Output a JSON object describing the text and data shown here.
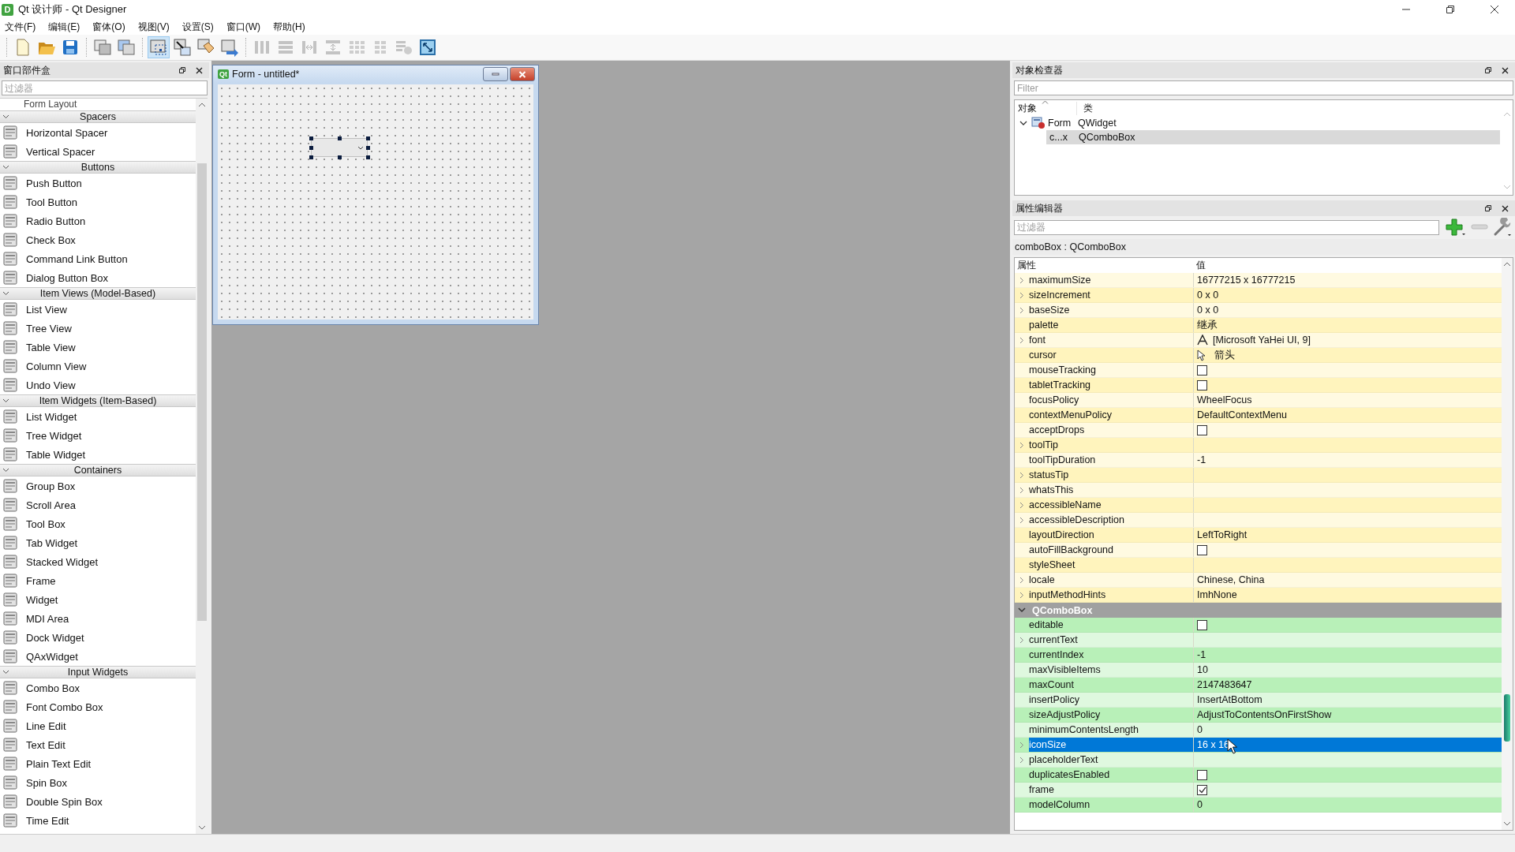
{
  "window": {
    "app_icon": "D",
    "title": "Qt 设计师 - Qt Designer"
  },
  "menu": [
    "文件(F)",
    "编辑(E)",
    "窗体(O)",
    "视图(V)",
    "设置(S)",
    "窗口(W)",
    "帮助(H)"
  ],
  "toolbar_groups": [
    [
      {
        "kind": "new",
        "selected": false,
        "disabled": false
      },
      {
        "kind": "open",
        "selected": false,
        "disabled": false
      },
      {
        "kind": "save",
        "selected": false,
        "disabled": false
      }
    ],
    [
      {
        "kind": "back",
        "selected": false,
        "disabled": false
      },
      {
        "kind": "front",
        "selected": false,
        "disabled": false
      }
    ],
    [
      {
        "kind": "widgets",
        "selected": true,
        "disabled": false
      },
      {
        "kind": "signals",
        "selected": false,
        "disabled": false
      },
      {
        "kind": "buddies",
        "selected": false,
        "disabled": false
      },
      {
        "kind": "taborder",
        "selected": false,
        "disabled": false
      }
    ],
    [
      {
        "kind": "hlayout",
        "selected": false,
        "disabled": true
      },
      {
        "kind": "vlayout",
        "selected": false,
        "disabled": true
      },
      {
        "kind": "hsplit",
        "selected": false,
        "disabled": true
      },
      {
        "kind": "vsplit",
        "selected": false,
        "disabled": true
      },
      {
        "kind": "grid",
        "selected": false,
        "disabled": true
      },
      {
        "kind": "form",
        "selected": false,
        "disabled": true
      },
      {
        "kind": "break",
        "selected": false,
        "disabled": true
      },
      {
        "kind": "adjust",
        "selected": false,
        "disabled": false
      }
    ]
  ],
  "widget_box": {
    "title": "窗口部件盒",
    "filter_placeholder": "过滤器",
    "clipped_item": "Form Layout",
    "categories": [
      {
        "title": "Spacers",
        "expanded": true,
        "items": [
          "Horizontal Spacer",
          "Vertical Spacer"
        ]
      },
      {
        "title": "Buttons",
        "expanded": true,
        "items": [
          "Push Button",
          "Tool Button",
          "Radio Button",
          "Check Box",
          "Command Link Button",
          "Dialog Button Box"
        ]
      },
      {
        "title": "Item Views (Model-Based)",
        "expanded": true,
        "items": [
          "List View",
          "Tree View",
          "Table View",
          "Column View",
          "Undo View"
        ]
      },
      {
        "title": "Item Widgets (Item-Based)",
        "expanded": true,
        "items": [
          "List Widget",
          "Tree Widget",
          "Table Widget"
        ]
      },
      {
        "title": "Containers",
        "expanded": true,
        "items": [
          "Group Box",
          "Scroll Area",
          "Tool Box",
          "Tab Widget",
          "Stacked Widget",
          "Frame",
          "Widget",
          "MDI Area",
          "Dock Widget",
          "QAxWidget"
        ]
      },
      {
        "title": "Input Widgets",
        "expanded": true,
        "items": [
          "Combo Box",
          "Font Combo Box",
          "Line Edit",
          "Text Edit",
          "Plain Text Edit",
          "Spin Box",
          "Double Spin Box",
          "Time Edit"
        ]
      }
    ]
  },
  "form_window": {
    "logo": "Qt",
    "title": "Form - untitled*"
  },
  "object_inspector": {
    "title": "对象检查器",
    "filter_placeholder": "Filter",
    "columns": [
      "对象",
      "类"
    ],
    "tree": [
      {
        "object": "Form",
        "class": "QWidget",
        "expanded": true,
        "selected": false,
        "children": [
          {
            "object": "c...x",
            "class": "QComboBox",
            "selected": true
          }
        ]
      }
    ]
  },
  "property_editor": {
    "title": "属性编辑器",
    "filter_placeholder": "过滤器",
    "object_label": "comboBox : QComboBox",
    "columns": [
      "属性",
      "值"
    ],
    "groups": [
      {
        "color": "#fff4bd",
        "rows": [
          {
            "name": "maximumSize",
            "kind": "text",
            "value": "16777215 x 16777215",
            "expandable": true,
            "selected": false
          },
          {
            "name": "sizeIncrement",
            "kind": "text",
            "value": "0 x 0",
            "expandable": true,
            "selected": false
          },
          {
            "name": "baseSize",
            "kind": "text",
            "value": "0 x 0",
            "expandable": true,
            "selected": false
          },
          {
            "name": "palette",
            "kind": "text",
            "value": "继承",
            "expandable": false,
            "selected": false
          },
          {
            "name": "font",
            "kind": "font",
            "value": "[Microsoft YaHei UI, 9]",
            "expandable": true,
            "selected": false
          },
          {
            "name": "cursor",
            "kind": "cursor",
            "value": "箭头",
            "expandable": false,
            "selected": false
          },
          {
            "name": "mouseTracking",
            "kind": "checkbox",
            "checked": false,
            "expandable": false,
            "selected": false
          },
          {
            "name": "tabletTracking",
            "kind": "checkbox",
            "checked": false,
            "expandable": false,
            "selected": false
          },
          {
            "name": "focusPolicy",
            "kind": "text",
            "value": "WheelFocus",
            "expandable": false,
            "selected": false
          },
          {
            "name": "contextMenuPolicy",
            "kind": "text",
            "value": "DefaultContextMenu",
            "expandable": false,
            "selected": false
          },
          {
            "name": "acceptDrops",
            "kind": "checkbox",
            "checked": false,
            "expandable": false,
            "selected": false
          },
          {
            "name": "toolTip",
            "kind": "text",
            "expandable": true,
            "selected": false
          },
          {
            "name": "toolTipDuration",
            "kind": "text",
            "value": "-1",
            "expandable": false,
            "selected": false
          },
          {
            "name": "statusTip",
            "kind": "text",
            "expandable": true,
            "selected": false
          },
          {
            "name": "whatsThis",
            "kind": "text",
            "expandable": true,
            "selected": false
          },
          {
            "name": "accessibleName",
            "kind": "text",
            "expandable": true,
            "selected": false
          },
          {
            "name": "accessibleDescription",
            "kind": "text",
            "expandable": true,
            "selected": false
          },
          {
            "name": "layoutDirection",
            "kind": "text",
            "value": "LeftToRight",
            "expandable": false,
            "selected": false
          },
          {
            "name": "autoFillBackground",
            "kind": "checkbox",
            "checked": false,
            "expandable": false,
            "selected": false
          },
          {
            "name": "styleSheet",
            "kind": "text",
            "expandable": false,
            "selected": false
          },
          {
            "name": "locale",
            "kind": "text",
            "value": "Chinese, China",
            "expandable": true,
            "selected": false
          },
          {
            "name": "inputMethodHints",
            "kind": "text",
            "value": "ImhNone",
            "expandable": true,
            "selected": false
          }
        ]
      },
      {
        "title": "QComboBox",
        "expanded": true,
        "color": "#b8f0b8",
        "rows": [
          {
            "name": "editable",
            "kind": "checkbox",
            "checked": false,
            "expandable": false,
            "selected": false
          },
          {
            "name": "currentText",
            "kind": "text",
            "expandable": true,
            "selected": false
          },
          {
            "name": "currentIndex",
            "kind": "text",
            "value": "-1",
            "expandable": false,
            "selected": false
          },
          {
            "name": "maxVisibleItems",
            "kind": "text",
            "value": "10",
            "expandable": false,
            "selected": false
          },
          {
            "name": "maxCount",
            "kind": "text",
            "value": "2147483647",
            "expandable": false,
            "selected": false
          },
          {
            "name": "insertPolicy",
            "kind": "text",
            "value": "InsertAtBottom",
            "expandable": false,
            "selected": false
          },
          {
            "name": "sizeAdjustPolicy",
            "kind": "text",
            "value": "AdjustToContentsOnFirstShow",
            "expandable": false,
            "selected": false
          },
          {
            "name": "minimumContentsLength",
            "kind": "text",
            "value": "0",
            "expandable": false,
            "selected": false
          },
          {
            "name": "iconSize",
            "kind": "text",
            "value": "16 x 16",
            "expandable": true,
            "selected": true
          },
          {
            "name": "placeholderText",
            "kind": "text",
            "expandable": true,
            "selected": false
          },
          {
            "name": "duplicatesEnabled",
            "kind": "checkbox",
            "checked": false,
            "expandable": false,
            "selected": false
          },
          {
            "name": "frame",
            "kind": "checkbox",
            "checked": true,
            "expandable": false,
            "selected": false
          },
          {
            "name": "modelColumn",
            "kind": "text",
            "value": "0",
            "expandable": false,
            "selected": false
          }
        ]
      }
    ]
  }
}
